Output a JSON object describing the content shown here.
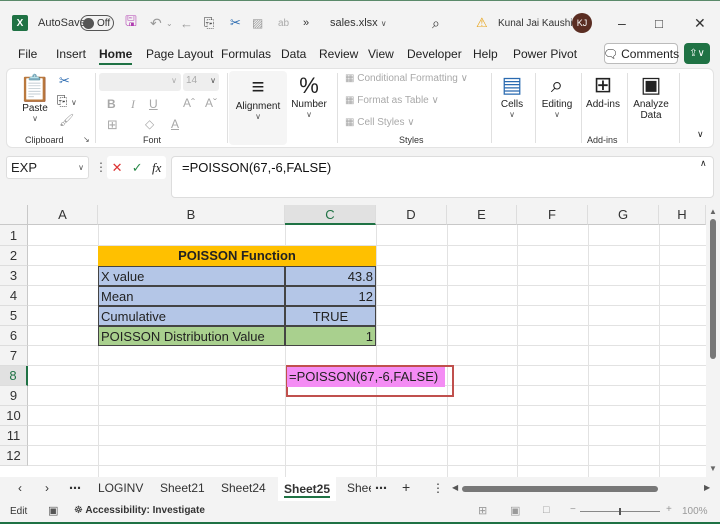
{
  "titlebar": {
    "app_icon": "excel-icon",
    "autosave_label": "AutoSave",
    "autosave_state": "Off",
    "filename": "sales.xlsx",
    "user_name": "Kunal Jai Kaushik",
    "user_initials": "KJ",
    "overflow": "»"
  },
  "menu": {
    "tabs": [
      "File",
      "Insert",
      "Home",
      "Page Layout",
      "Formulas",
      "Data",
      "Review",
      "View",
      "Developer",
      "Help",
      "Power Pivot"
    ],
    "active": "Home",
    "comments_label": "Comments"
  },
  "ribbon": {
    "clipboard": {
      "paste": "Paste",
      "group": "Clipboard"
    },
    "font": {
      "size": "14",
      "group": "Font"
    },
    "alignment": "Alignment",
    "number": "Number",
    "styles": {
      "conditional": "Conditional Formatting",
      "format_table": "Format as Table",
      "cell_styles": "Cell Styles",
      "group": "Styles"
    },
    "cells": "Cells",
    "editing": "Editing",
    "addins": {
      "button": "Add-ins",
      "group": "Add-ins"
    },
    "analyze": {
      "line1": "Analyze",
      "line2": "Data"
    }
  },
  "formula_bar": {
    "name_box": "EXP",
    "formula": "=POISSON(67,-6,FALSE)"
  },
  "grid": {
    "columns": [
      "A",
      "B",
      "C",
      "D",
      "E",
      "F",
      "G",
      "H"
    ],
    "selected_column": "C",
    "rows": [
      "1",
      "2",
      "3",
      "4",
      "5",
      "6",
      "7",
      "8",
      "9",
      "10",
      "11",
      "12"
    ],
    "selected_row": "8",
    "table": {
      "title": "POISSON Function",
      "rows": [
        {
          "label": "X value",
          "value": "43.8"
        },
        {
          "label": "Mean",
          "value": "12"
        },
        {
          "label": "Cumulative",
          "value": "TRUE"
        },
        {
          "label": "POISSON Distribution Value",
          "value": "1"
        }
      ]
    },
    "editing_cell_text": "=POISSON(67,-6,FALSE)"
  },
  "colors": {
    "header_fill": "#ffc000",
    "data_fill": "#b4c6e7",
    "result_fill": "#a9d08e",
    "edit_highlight": "#f48cf4",
    "edit_box_border": "#c0504d",
    "accent": "#1f7244"
  },
  "sheets": {
    "tabs": [
      "LOGINV",
      "Sheet21",
      "Sheet24",
      "Sheet25",
      "Shee"
    ],
    "active": "Sheet25"
  },
  "status": {
    "mode": "Edit",
    "accessibility": "Accessibility: Investigate",
    "zoom": "100%"
  }
}
